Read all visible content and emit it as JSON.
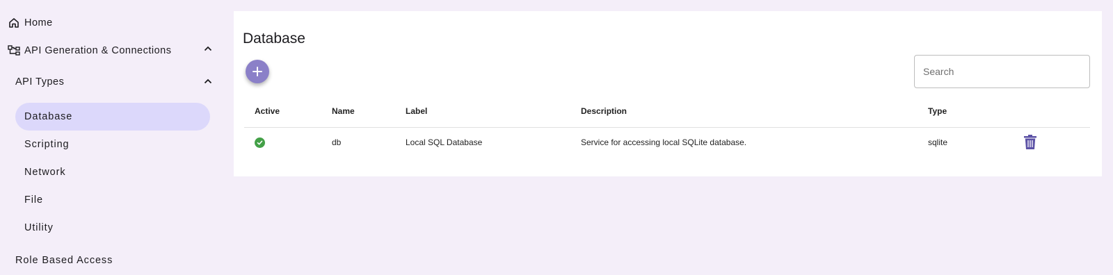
{
  "sidebar": {
    "home": {
      "label": "Home",
      "icon": "home-icon"
    },
    "api_generation": {
      "label": "API Generation & Connections",
      "icon": "hierarchy-icon",
      "expanded": true
    },
    "api_types": {
      "label": "API Types",
      "expanded": true
    },
    "items": [
      {
        "label": "Database",
        "active": true
      },
      {
        "label": "Scripting",
        "active": false
      },
      {
        "label": "Network",
        "active": false
      },
      {
        "label": "File",
        "active": false
      },
      {
        "label": "Utility",
        "active": false
      }
    ],
    "role_based_access": {
      "label": "Role Based Access"
    }
  },
  "main": {
    "title": "Database",
    "search": {
      "placeholder": "Search",
      "value": ""
    },
    "table": {
      "headers": {
        "active": "Active",
        "name": "Name",
        "label": "Label",
        "description": "Description",
        "type": "Type"
      },
      "rows": [
        {
          "active": true,
          "name": "db",
          "label": "Local SQL Database",
          "description": "Service for accessing local SQLite database.",
          "type": "sqlite"
        }
      ]
    }
  },
  "colors": {
    "background": "#f4eef9",
    "active_nav": "#dcd8fb",
    "accent": "#8b80c8",
    "trash": "#5c52a6",
    "success": "#43a047"
  }
}
